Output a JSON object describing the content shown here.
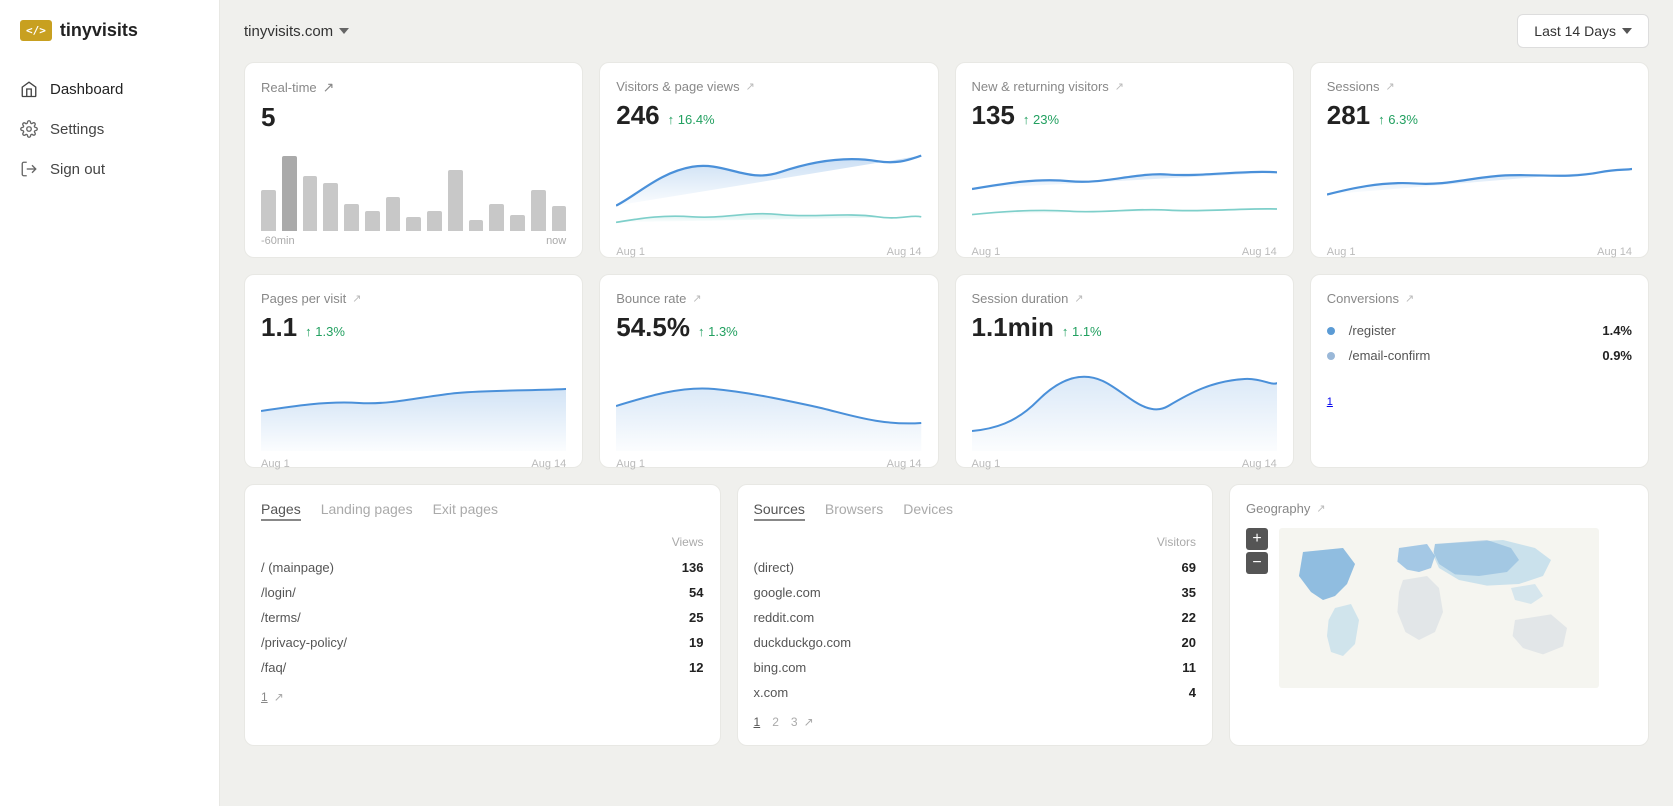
{
  "logo": {
    "icon": "</> ",
    "text": "tinyvisits"
  },
  "nav": {
    "items": [
      {
        "id": "dashboard",
        "label": "Dashboard",
        "icon": "home",
        "active": true
      },
      {
        "id": "settings",
        "label": "Settings",
        "icon": "settings",
        "active": false
      },
      {
        "id": "signout",
        "label": "Sign out",
        "icon": "signout",
        "active": false
      }
    ]
  },
  "header": {
    "site": "tinyvisits.com",
    "date_range": "Last 14 Days"
  },
  "realtime": {
    "title": "Real-time",
    "value": "5",
    "label_start": "-60min",
    "label_end": "now",
    "bars": [
      30,
      55,
      40,
      35,
      20,
      15,
      25,
      10,
      15,
      45,
      8,
      20,
      12,
      30,
      18
    ]
  },
  "visitors": {
    "title": "Visitors & page views",
    "value": "246",
    "change": "↑ 16.4%",
    "date_start": "Aug 1",
    "date_end": "Aug 14"
  },
  "new_returning": {
    "title": "New & returning visitors",
    "value": "135",
    "change": "↑ 23%",
    "date_start": "Aug 1",
    "date_end": "Aug 14"
  },
  "sessions": {
    "title": "Sessions",
    "value": "281",
    "change": "↑ 6.3%",
    "date_start": "Aug 1",
    "date_end": "Aug 14"
  },
  "pages_per_visit": {
    "title": "Pages per visit",
    "value": "1.1",
    "change": "↑ 1.3%",
    "date_start": "Aug 1",
    "date_end": "Aug 14"
  },
  "bounce_rate": {
    "title": "Bounce rate",
    "value": "54.5%",
    "change": "↑ 1.3%",
    "date_start": "Aug 1",
    "date_end": "Aug 14"
  },
  "session_duration": {
    "title": "Session duration",
    "value": "1.1min",
    "change": "↑ 1.1%",
    "date_start": "Aug 1",
    "date_end": "Aug 14"
  },
  "conversions": {
    "title": "Conversions",
    "items": [
      {
        "name": "/register",
        "value": "1.4%",
        "color": "#5b9bd5"
      },
      {
        "name": "/email-confirm",
        "value": "0.9%",
        "color": "#9ab8d8"
      }
    ],
    "page_link": "1"
  },
  "pages": {
    "tabs": [
      "Pages",
      "Landing pages",
      "Exit pages"
    ],
    "active_tab": "Pages",
    "col_label": "Views",
    "rows": [
      {
        "path": "/ (mainpage)",
        "views": "136"
      },
      {
        "path": "/login/",
        "views": "54"
      },
      {
        "path": "/terms/",
        "views": "25"
      },
      {
        "path": "/privacy-policy/",
        "views": "19"
      },
      {
        "path": "/faq/",
        "views": "12"
      }
    ],
    "pagination": "1"
  },
  "sources": {
    "tabs": [
      "Sources",
      "Browsers",
      "Devices"
    ],
    "active_tab": "Sources",
    "col_label": "Visitors",
    "rows": [
      {
        "source": "(direct)",
        "count": "69"
      },
      {
        "source": "google.com",
        "count": "35"
      },
      {
        "source": "reddit.com",
        "count": "22"
      },
      {
        "source": "duckduckgo.com",
        "count": "20"
      },
      {
        "source": "bing.com",
        "count": "11"
      },
      {
        "source": "x.com",
        "count": "4"
      }
    ],
    "pagination": [
      "1",
      "2",
      "3"
    ]
  },
  "geography": {
    "title": "Geography",
    "zoom_in": "+",
    "zoom_out": "−"
  }
}
